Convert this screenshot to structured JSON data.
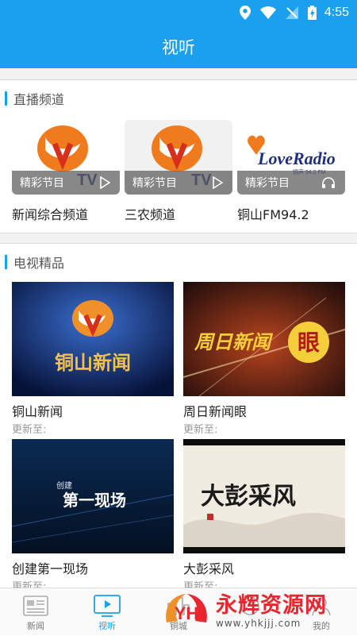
{
  "status_bar": {
    "time": "4:55"
  },
  "header": {
    "title": "视听"
  },
  "live_section": {
    "title": "直播频道",
    "channels": [
      {
        "name": "新闻综合频道",
        "overlay_label": "精彩节目",
        "logo_text": "TV",
        "action": "play"
      },
      {
        "name": "三农频道",
        "overlay_label": "精彩节目",
        "logo_text": "TV",
        "action": "play"
      },
      {
        "name": "铜山FM94.2",
        "overlay_label": "精彩节目",
        "logo_text": "LoveRadio",
        "logo_sub": "铜声 94.2 FM",
        "action": "listen"
      }
    ]
  },
  "tv_section": {
    "title": "电视精品",
    "programs": [
      {
        "title": "铜山新闻",
        "update_label": "更新至:",
        "poster_text": "铜山新闻"
      },
      {
        "title": "周日新闻眼",
        "update_label": "更新至:",
        "poster_text": "周日新闻",
        "poster_accent": "眼"
      },
      {
        "title": "创建第一现场",
        "update_label": "更新至:",
        "poster_small": "创建",
        "poster_text": "第一现场"
      },
      {
        "title": "大彭采风",
        "update_label": "更新至:",
        "poster_text": "大彭采风"
      }
    ]
  },
  "tab_bar": {
    "tabs": [
      {
        "label": "新闻",
        "icon": "news-icon",
        "active": false
      },
      {
        "label": "视听",
        "icon": "video-icon",
        "active": true
      },
      {
        "label": "铜城",
        "icon": "city-icon",
        "active": false
      },
      {
        "label": "",
        "icon": "service-icon",
        "active": false
      },
      {
        "label": "我的",
        "icon": "profile-icon",
        "active": false
      }
    ]
  },
  "watermark": {
    "brand": "永辉资源网",
    "url": "www.yhkjjj.com",
    "logo_letters": "YH"
  },
  "colors": {
    "accent": "#1aa0ec",
    "logo_orange": "#f07a1e",
    "logo_red": "#d6301c",
    "watermark_red": "#e8262d"
  }
}
